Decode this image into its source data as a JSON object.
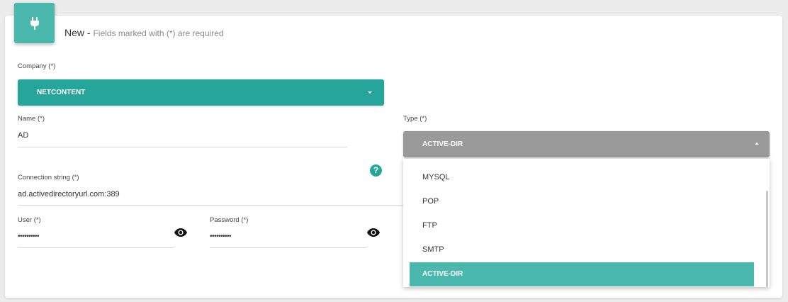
{
  "header": {
    "title": "New",
    "separator": " - ",
    "hint": "Fields marked with (*) are required",
    "icon": "plug-icon"
  },
  "company": {
    "label": "Company (*)",
    "value": "NETCONTENT"
  },
  "name": {
    "label": "Name (*)",
    "value": "AD"
  },
  "type": {
    "label": "Type (*)",
    "value": "ACTIVE-DIR",
    "options": [
      "MYSQL",
      "POP",
      "FTP",
      "SMTP",
      "ACTIVE-DIR"
    ]
  },
  "connection": {
    "label": "Connection string (*)",
    "value": "ad.activedirectoryurl.com:389"
  },
  "user": {
    "label": "User (*)",
    "value": "••••••••••"
  },
  "password": {
    "label": "Password (*)",
    "value": "••••••••••"
  },
  "colors": {
    "accent": "#26a69a",
    "active_item": "#4ab8ac",
    "disabled_select": "#9a9a9a"
  }
}
